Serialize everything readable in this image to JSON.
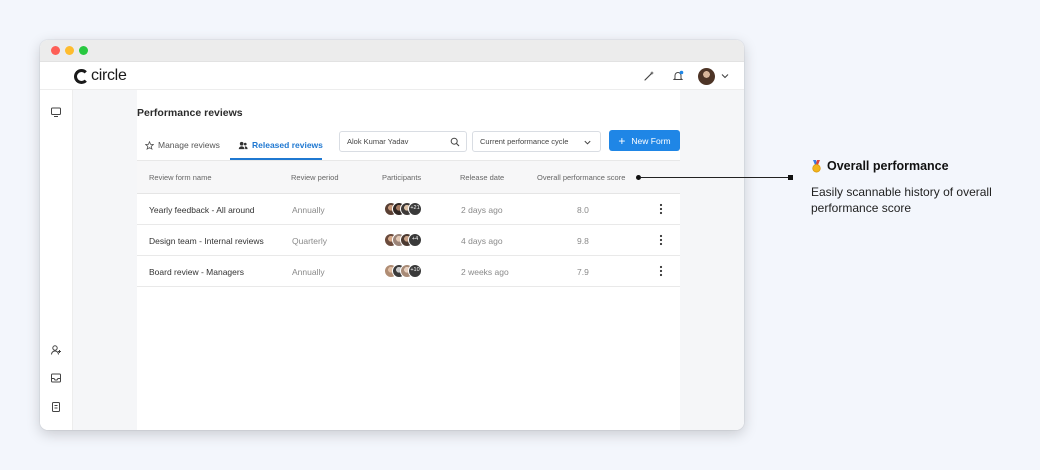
{
  "app": {
    "logo_text": "circle"
  },
  "page": {
    "title": "Performance reviews",
    "tabs": [
      {
        "label": "Manage reviews",
        "icon": "star-icon",
        "active": false
      },
      {
        "label": "Released reviews",
        "icon": "users-icon",
        "active": true
      }
    ],
    "search": {
      "value": "Alok Kumar Yadav"
    },
    "cycle_select": {
      "value": "Current performance cycle"
    },
    "new_form_label": "New Form"
  },
  "table": {
    "columns": [
      "Review form name",
      "Review period",
      "Participants",
      "Release date",
      "Overall performance score"
    ],
    "rows": [
      {
        "name": "Yearly feedback - All around",
        "period": "Annually",
        "participants_extra": "+21",
        "date": "2 days ago",
        "score": "8.0"
      },
      {
        "name": "Design team - Internal reviews",
        "period": "Quarterly",
        "participants_extra": "+4",
        "date": "4 days ago",
        "score": "9.8"
      },
      {
        "name": "Board review - Managers",
        "period": "Annually",
        "participants_extra": "+10",
        "date": "2 weeks ago",
        "score": "7.9"
      }
    ]
  },
  "callout": {
    "title": "Overall performance",
    "description": "Easily scannable history of overall performance score"
  },
  "colors": {
    "accent": "#1f86e6",
    "tab_active": "#1f78d1",
    "background": "#f3f6fc"
  }
}
